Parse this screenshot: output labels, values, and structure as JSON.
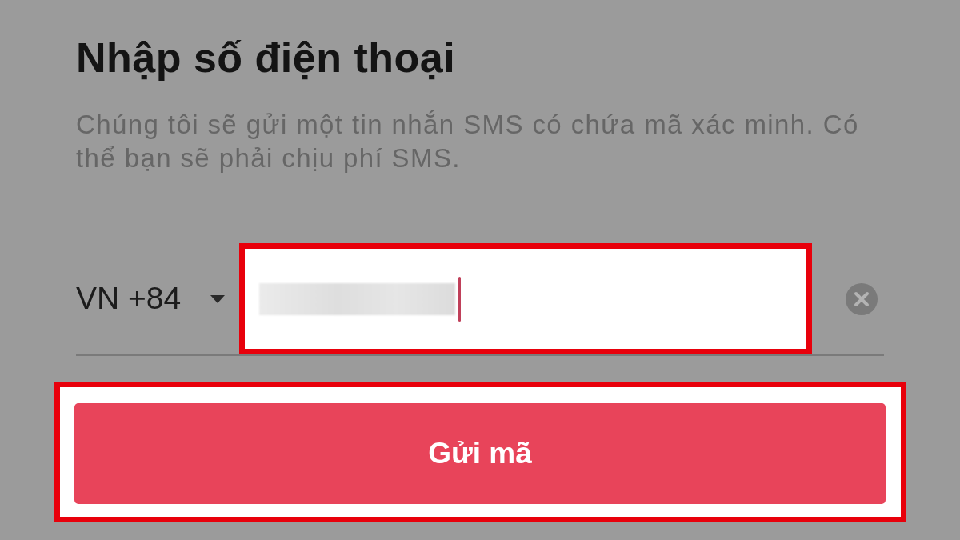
{
  "title": "Nhập số điện thoại",
  "description": "Chúng tôi sẽ gửi một tin nhắn SMS có chứa mã xác minh. Có thể bạn sẽ phải chịu phí SMS.",
  "phone": {
    "country_code": "VN +84",
    "value_redacted": true,
    "focused": true,
    "highlighted": true
  },
  "send_button": {
    "label": "Gửi mã",
    "highlighted": true
  }
}
